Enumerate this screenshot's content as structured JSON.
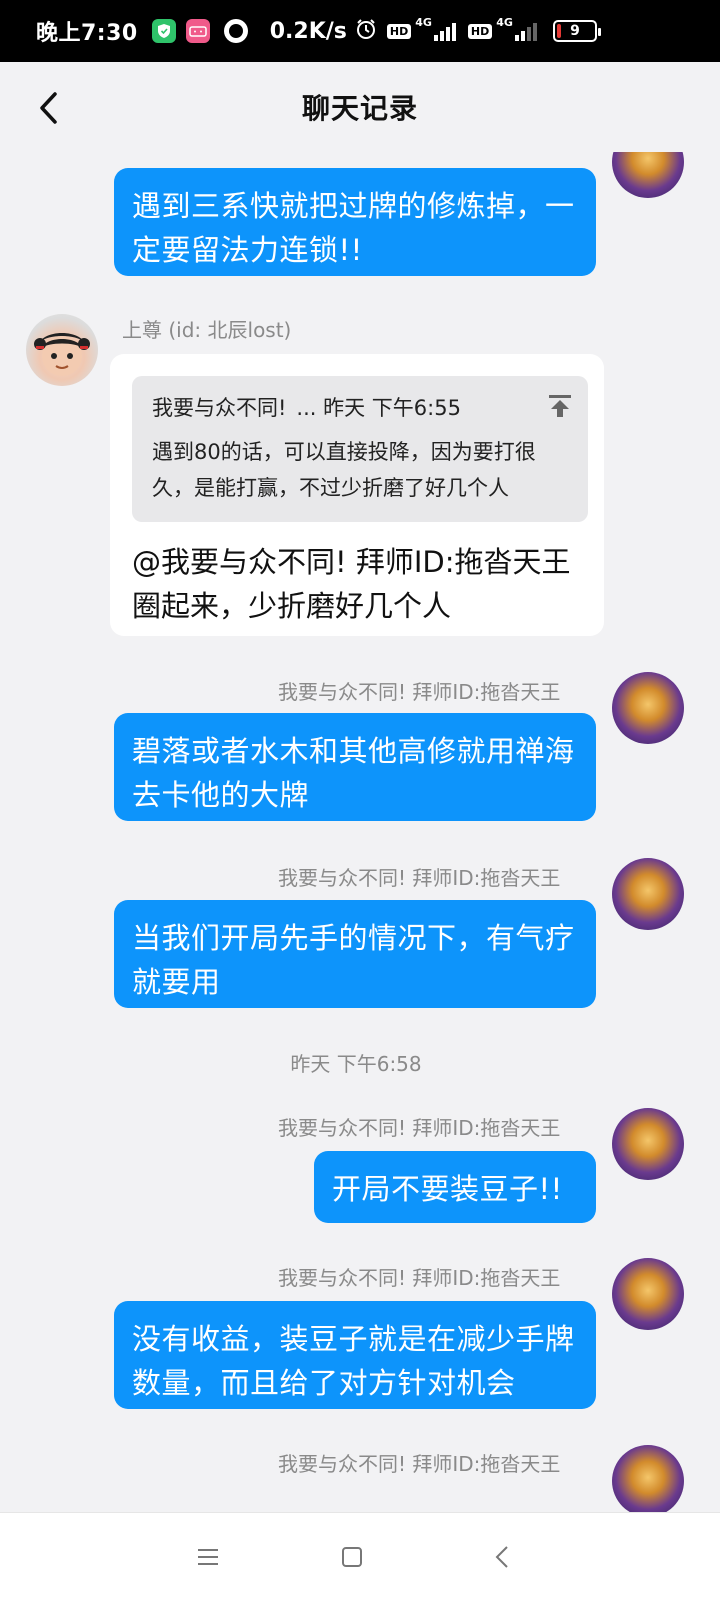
{
  "status_bar": {
    "time": "晚上7:30",
    "net_speed": "0.2K/s",
    "network_type": "4G",
    "hd_label": "HD",
    "battery": "9",
    "icons": [
      "shield-app-icon",
      "bilibili-app-icon",
      "circle-app-icon",
      "alarm-icon",
      "signal-icon",
      "battery-icon"
    ]
  },
  "header": {
    "title": "聊天记录",
    "back_icon": "chevron-left-icon"
  },
  "messages": [
    {
      "side": "right",
      "text": "遇到三系快就把过牌的修炼掉，一定要留法力连锁!!"
    },
    {
      "side": "left",
      "sender": "上尊 (id: 北辰lost)",
      "quote_from": "我要与众不同!",
      "quote_time": "... 昨天 下午6:55",
      "quote_text": "遇到80的话，可以直接投降，因为要打很久，是能打赢，不过少折磨了好几个人",
      "text": "@我要与众不同!   拜师ID:拖沓天王 圈起来，少折磨好几个人"
    },
    {
      "side": "right",
      "sender": "我要与众不同!   拜师ID:拖沓天王",
      "text": "碧落或者水木和其他高修就用禅海去卡他的大牌"
    },
    {
      "side": "right",
      "sender": "我要与众不同!   拜师ID:拖沓天王",
      "text": "当我们开局先手的情况下，有气疗就要用"
    },
    {
      "side": "right",
      "sender": "我要与众不同!   拜师ID:拖沓天王",
      "text": "开局不要装豆子!!"
    },
    {
      "side": "right",
      "sender": "我要与众不同!   拜师ID:拖沓天王",
      "text": "没有收益，装豆子就是在减少手牌数量，而且给了对方针对机会"
    },
    {
      "side": "right",
      "sender": "我要与众不同!   拜师ID:拖沓天王"
    }
  ],
  "timestamp": "昨天 下午6:58",
  "colors": {
    "bubble_blue": "#0d94fb",
    "background": "#f2f2f4",
    "quote_bg": "#e8e8ea"
  },
  "nav": {
    "menu_icon": "menu-icon",
    "home_icon": "square-home-icon",
    "back_icon": "triangle-back-icon"
  }
}
